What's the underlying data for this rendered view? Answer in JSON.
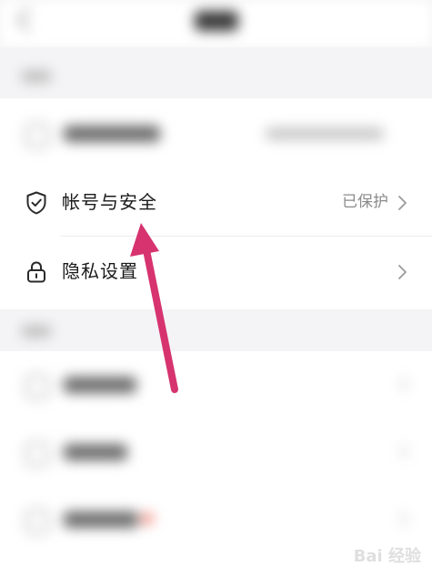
{
  "rows": {
    "account_security": {
      "label": "帐号与安全",
      "value": "已保护",
      "icon": "shield-check-icon"
    },
    "privacy": {
      "label": "隐私设置",
      "icon": "lock-icon"
    }
  },
  "watermark": "Bai 经验",
  "annotation": {
    "color": "#d6336f"
  }
}
